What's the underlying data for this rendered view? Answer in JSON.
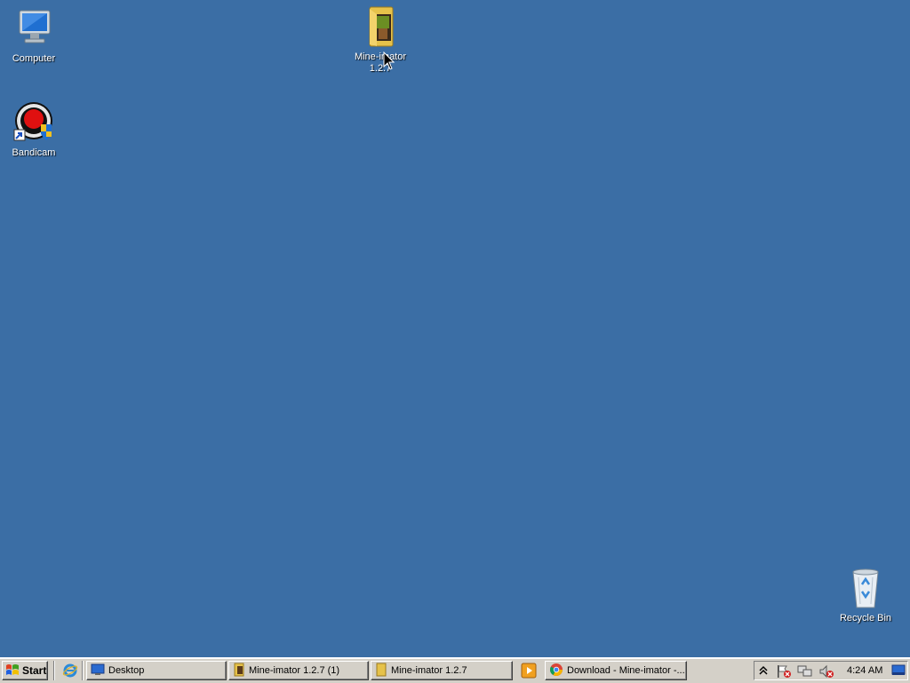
{
  "desktop": {
    "background": "#3b6ea5",
    "icons": [
      {
        "label": "Computer",
        "icon": "computer-icon"
      },
      {
        "label": "Mine-imator 1.2.7",
        "line1": "Mine-imator",
        "line2": "1.2.7",
        "icon": "folder-icon"
      },
      {
        "label": "Bandicam",
        "icon": "bandicam-icon"
      },
      {
        "label": "Recycle Bin",
        "icon": "recycle-bin-icon"
      }
    ]
  },
  "taskbar": {
    "start_label": "Start",
    "quick_launch": [
      {
        "icon": "internet-explorer-icon"
      }
    ],
    "tasks": [
      {
        "label": "Desktop",
        "icon": "desktop-icon"
      },
      {
        "label": "Mine-imator 1.2.7 (1)",
        "icon": "folder-icon"
      },
      {
        "label": "Mine-imator 1.2.7",
        "icon": "folder-icon"
      },
      {
        "label": "Download - Mine-imator -...",
        "icon": "chrome-icon"
      }
    ],
    "media_icon": "media-player-icon",
    "tray": {
      "icons": [
        "tray-expand-icon",
        "flag-alert-icon",
        "network-icon",
        "volume-muted-icon",
        "show-desktop-icon"
      ],
      "clock": "4:24 AM"
    }
  }
}
